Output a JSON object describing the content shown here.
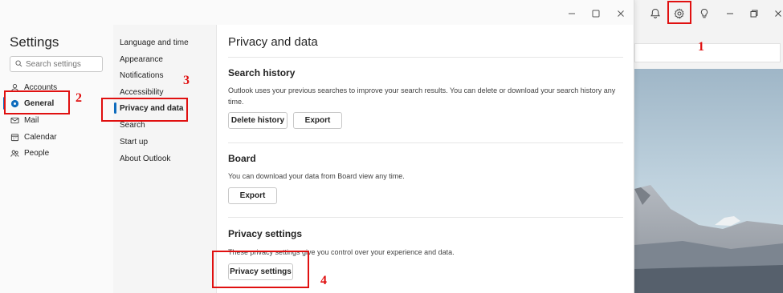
{
  "settings": {
    "title": "Settings",
    "search_placeholder": "Search settings",
    "categories": [
      {
        "label": "Accounts",
        "icon": "person-icon"
      },
      {
        "label": "General",
        "icon": "gear-icon",
        "active": true
      },
      {
        "label": "Mail",
        "icon": "mail-icon"
      },
      {
        "label": "Calendar",
        "icon": "calendar-icon"
      },
      {
        "label": "People",
        "icon": "people-icon"
      }
    ],
    "subcategories": [
      {
        "label": "Language and time"
      },
      {
        "label": "Appearance"
      },
      {
        "label": "Notifications"
      },
      {
        "label": "Accessibility"
      },
      {
        "label": "Privacy and data",
        "active": true
      },
      {
        "label": "Search"
      },
      {
        "label": "Start up"
      },
      {
        "label": "About Outlook"
      }
    ]
  },
  "content": {
    "title": "Privacy and data",
    "search_history": {
      "heading": "Search history",
      "description": "Outlook uses your previous searches to improve your search results. You can delete or download your search history any time.",
      "delete_label": "Delete history",
      "export_label": "Export"
    },
    "board": {
      "heading": "Board",
      "description": "You can download your data from Board view any time.",
      "export_label": "Export"
    },
    "privacy": {
      "heading": "Privacy settings",
      "description": "These privacy settings give you control over your experience and data.",
      "button_label": "Privacy settings"
    }
  },
  "annotations": {
    "step1": "1",
    "step2": "2",
    "step3": "3",
    "step4": "4"
  },
  "colors": {
    "accent": "#0f6cbd",
    "annotation": "#e01010"
  }
}
